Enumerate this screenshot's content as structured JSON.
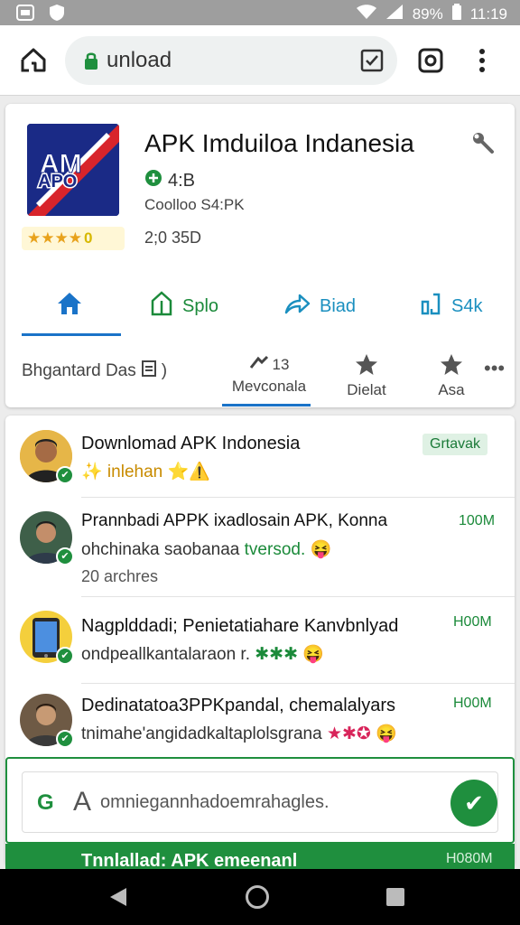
{
  "status_bar": {
    "battery": "89%",
    "time": "11:19",
    "icons": [
      "app-icon",
      "shield-icon",
      "wifi-icon",
      "signal-icon",
      "battery-icon"
    ]
  },
  "browser": {
    "url": "unload",
    "icons": [
      "home-icon",
      "lock-icon",
      "tabs-icon",
      "camera-icon",
      "more-vert-icon"
    ]
  },
  "app": {
    "title": "APK Imduiloa Indanesia",
    "logo_text": "APO",
    "rating_stars": "★★★★",
    "rating_badge": "0",
    "version": "4:B",
    "size_line": "Coolloo S4:PK",
    "date_line": "2;0 35D",
    "actions": [
      {
        "label": "",
        "icon": "home-icon"
      },
      {
        "label": "Splo",
        "icon": "bookmark-icon"
      },
      {
        "label": "Biad",
        "icon": "share-icon"
      },
      {
        "label": "S4k",
        "icon": "sdk-icon"
      }
    ],
    "subtabs": {
      "left_label": "Bhgantard Das",
      "tab1_top": "13",
      "tab1_label": "Mevconala",
      "tab2_label": "Dielat",
      "tab3_label": "Asa",
      "more": "•••"
    }
  },
  "list": [
    {
      "title": "Downlomad APK Indonesia",
      "subtitle": "✨ inlehan ⭐⚠️",
      "badge": "Grtavak",
      "extra": ""
    },
    {
      "title": "Prannbadi APPK ixadlosain APK, Konna",
      "subtitle": "ohchinaka saobanaa ",
      "subtitle_highlight": "tversod.",
      "emoji": "😝",
      "badge": "100M",
      "extra": "20 archres"
    },
    {
      "title": "Nagplddadi; Penietatiahare Kanvbnlyad",
      "subtitle": "ondpeallkantalaraon r. ",
      "subtitle_highlight": "✱✱✱",
      "emoji": "😝",
      "badge": "H00M",
      "extra": ""
    },
    {
      "title": "Dedinatatoa3PPKpandal, chemalalyars",
      "subtitle": "tnimahe'angidadkaltaplolsgrana ",
      "subtitle_highlight": "★✱✪",
      "emoji": "😝",
      "badge": "H00M",
      "extra": ""
    }
  ],
  "composer": {
    "logo": "G",
    "letter": "A",
    "placeholder": "omniegannhadoemrahagles.",
    "send_icon": "check-icon"
  },
  "peek": {
    "title": "Tnnlallad: APK emeenanl",
    "size": "H080M"
  },
  "nav": {
    "icons": [
      "back-icon",
      "home-circle-icon",
      "recents-icon"
    ]
  },
  "colors": {
    "accent_green": "#1f8f3e",
    "accent_blue": "#1a73c8",
    "share_blue": "#1a8fbf"
  }
}
